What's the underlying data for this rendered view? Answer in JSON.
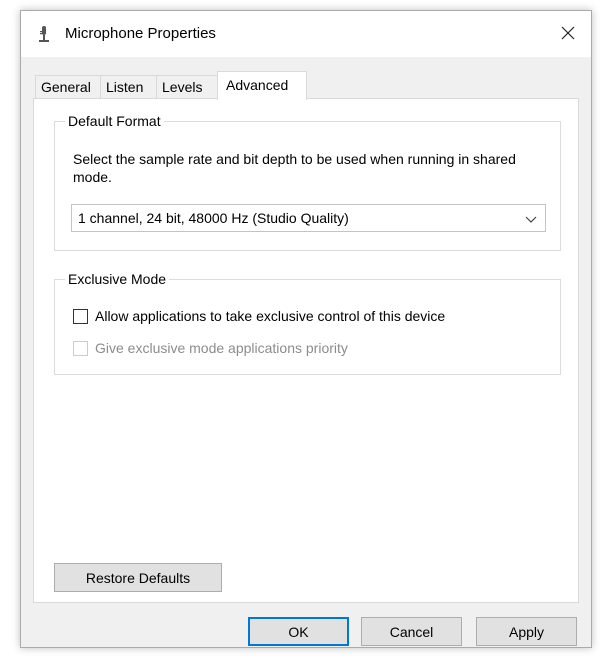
{
  "window": {
    "title": "Microphone Properties",
    "title_icon": "microphone-icon",
    "close_icon": "close-icon"
  },
  "tabs": [
    {
      "label": "General",
      "active": false
    },
    {
      "label": "Listen",
      "active": false
    },
    {
      "label": "Levels",
      "active": false
    },
    {
      "label": "Advanced",
      "active": true
    }
  ],
  "default_format": {
    "group_label": "Default Format",
    "description": "Select the sample rate and bit depth to be used when running in shared mode.",
    "selected_format": "1 channel, 24 bit, 48000 Hz (Studio Quality)",
    "chevron_icon": "chevron-down-icon"
  },
  "exclusive_mode": {
    "group_label": "Exclusive Mode",
    "allow_exclusive_label": "Allow applications to take exclusive control of this device",
    "allow_exclusive_checked": false,
    "priority_label": "Give exclusive mode applications priority",
    "priority_checked": false,
    "priority_disabled": true
  },
  "restore_defaults_label": "Restore Defaults",
  "footer": {
    "ok_label": "OK",
    "cancel_label": "Cancel",
    "apply_label": "Apply"
  },
  "colors": {
    "accent": "#0078d7",
    "window_bg": "#f0f0f0",
    "panel_bg": "#ffffff",
    "disabled_text": "#8c8c8c"
  }
}
